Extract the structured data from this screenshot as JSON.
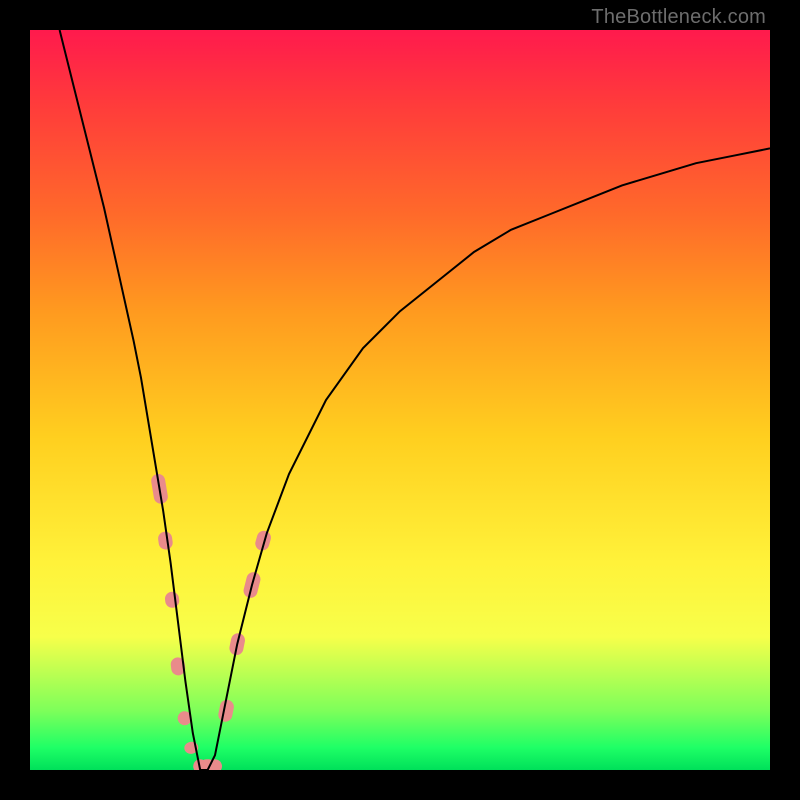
{
  "attribution": {
    "text": "TheBottleneck.com"
  },
  "chart_data": {
    "type": "line",
    "title": "",
    "xlabel": "",
    "ylabel": "",
    "xlim": [
      0,
      100
    ],
    "ylim": [
      0,
      100
    ],
    "grid": false,
    "legend": false,
    "series": [
      {
        "name": "bottleneck-curve",
        "stroke": "#000000",
        "x": [
          4,
          6,
          8,
          10,
          12,
          14,
          15,
          16,
          17,
          18,
          19,
          20,
          21,
          22,
          23,
          24,
          25,
          26,
          27,
          28,
          30,
          32,
          35,
          40,
          45,
          50,
          55,
          60,
          65,
          70,
          75,
          80,
          85,
          90,
          95,
          100
        ],
        "y": [
          100,
          92,
          84,
          76,
          67,
          58,
          53,
          47,
          41,
          35,
          28,
          20,
          12,
          5,
          0,
          0,
          2,
          7,
          12,
          17,
          25,
          32,
          40,
          50,
          57,
          62,
          66,
          70,
          73,
          75,
          77,
          79,
          80.5,
          82,
          83,
          84
        ]
      }
    ],
    "markers": {
      "name": "highlight-dots",
      "fill": "#e98b8b",
      "stroke": "#e98b8b",
      "shape": "rounded-bar",
      "points": [
        {
          "x": 17.5,
          "y": 38,
          "len": 30
        },
        {
          "x": 18.3,
          "y": 31,
          "len": 18
        },
        {
          "x": 19.2,
          "y": 23,
          "len": 16
        },
        {
          "x": 20.0,
          "y": 14,
          "len": 18
        },
        {
          "x": 20.9,
          "y": 7,
          "len": 14
        },
        {
          "x": 21.8,
          "y": 3,
          "len": 12
        },
        {
          "x": 23.0,
          "y": 0.5,
          "len": 14
        },
        {
          "x": 24.0,
          "y": 0.5,
          "len": 16
        },
        {
          "x": 25.0,
          "y": 0.5,
          "len": 14
        },
        {
          "x": 26.5,
          "y": 8,
          "len": 22
        },
        {
          "x": 28.0,
          "y": 17,
          "len": 22
        },
        {
          "x": 30.0,
          "y": 25,
          "len": 26
        },
        {
          "x": 31.5,
          "y": 31,
          "len": 20
        }
      ]
    },
    "colors": {
      "curve": "#000000",
      "markers": "#e98b8b",
      "bg_top": "#ff1a4d",
      "bg_bottom": "#00e05a"
    }
  }
}
